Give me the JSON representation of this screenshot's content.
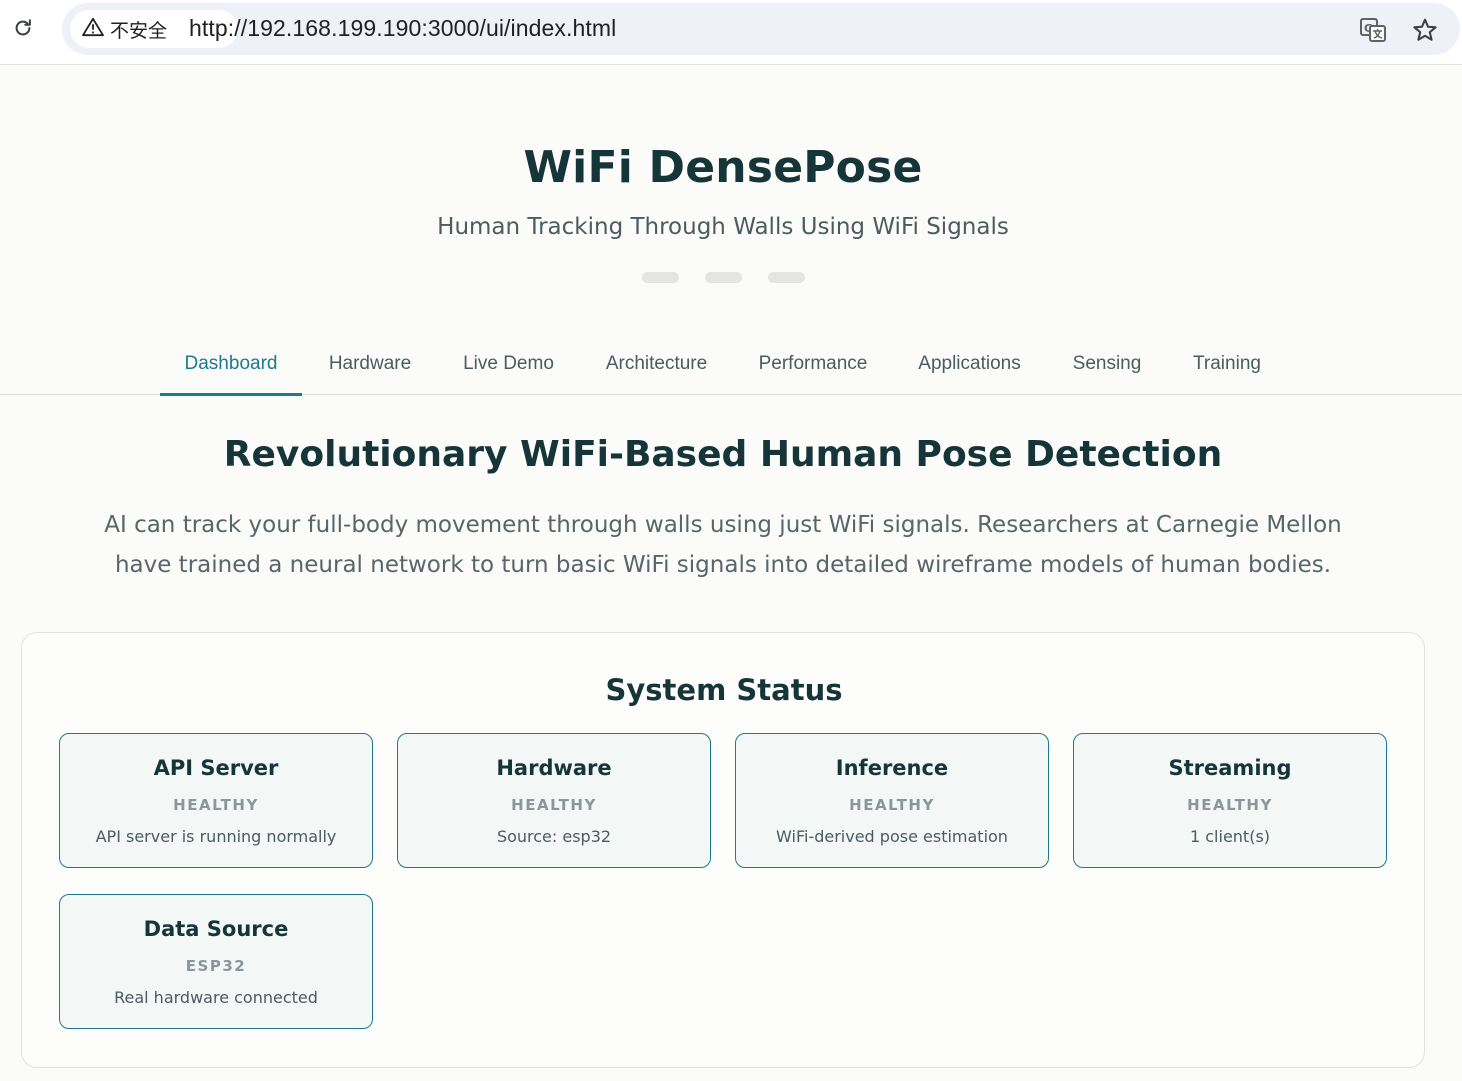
{
  "browser": {
    "security_label": "不安全",
    "url": "http://192.168.199.190:3000/ui/index.html"
  },
  "header": {
    "title": "WiFi DensePose",
    "subtitle": "Human Tracking Through Walls Using WiFi Signals"
  },
  "tabs": [
    {
      "label": "Dashboard",
      "active": true
    },
    {
      "label": "Hardware"
    },
    {
      "label": "Live Demo"
    },
    {
      "label": "Architecture"
    },
    {
      "label": "Performance"
    },
    {
      "label": "Applications"
    },
    {
      "label": "Sensing"
    },
    {
      "label": "Training"
    }
  ],
  "hero": {
    "title": "Revolutionary WiFi-Based Human Pose Detection",
    "text": "AI can track your full-body movement through walls using just WiFi signals. Researchers at Carnegie Mellon have trained a neural network to turn basic WiFi signals into detailed wireframe models of human bodies."
  },
  "status": {
    "heading": "System Status",
    "cards": [
      {
        "title": "API Server",
        "state": "HEALTHY",
        "detail": "API server is running normally"
      },
      {
        "title": "Hardware",
        "state": "HEALTHY",
        "detail": "Source: esp32"
      },
      {
        "title": "Inference",
        "state": "HEALTHY",
        "detail": "WiFi-derived pose estimation"
      },
      {
        "title": "Streaming",
        "state": "HEALTHY",
        "detail": "1 client(s)"
      },
      {
        "title": "Data Source",
        "state": "ESP32",
        "detail": "Real hardware connected"
      }
    ]
  },
  "colors": {
    "accent": "#1d7a8c",
    "heading": "#163538",
    "background": "#fbfbf9"
  },
  "icons": {
    "reload": "reload-icon",
    "warning": "warning-triangle-icon",
    "translate": "translate-icon",
    "bookmark": "star-icon"
  }
}
